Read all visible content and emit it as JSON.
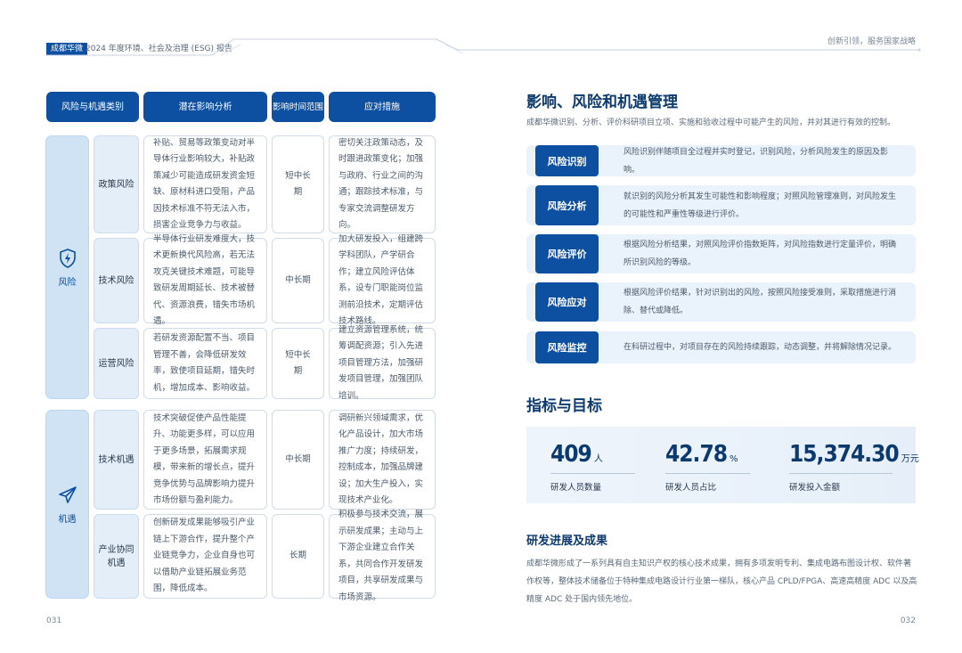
{
  "header": {
    "badge": "成都华微",
    "title": "2024 年度环境、社会及治理 (ESG) 报告",
    "slogan": "创新引领，服务国家战略"
  },
  "table": {
    "headers": [
      "风险与机遇类别",
      "潜在影响分析",
      "影响时间范围",
      "应对措施"
    ],
    "categories": [
      {
        "label": "风险",
        "icon": "shield-lightning-icon",
        "rows": [
          {
            "type": "政策风险",
            "impact": "补贴、贸易等政策变动对半导体行业影响较大，补贴政策减少可能造成研发资金短缺、原材料进口受阻，产品因技术标准不符无法入市，损害企业竞争力与收益。",
            "range": "短中长期",
            "measure": "密切关注政策动态，及时跟进政策变化；加强与政府、行业之间的沟通；跟踪技术标准，与专家交流调整研发方向。"
          },
          {
            "type": "技术风险",
            "impact": "半导体行业研发难度大，技术更新换代风险高，若无法攻克关键技术难题，可能导致研发周期延长、技术被替代、资源浪费，错失市场机遇。",
            "range": "中长期",
            "measure": "加大研发投入，组建跨学科团队，产学研合作；建立风险评估体系，设专门职能岗位监测前沿技术，定期评估技术路线。"
          },
          {
            "type": "运营风险",
            "impact": "若研发资源配置不当、项目管理不善，会降低研发效率，致使项目延期，错失时机，增加成本、影响收益。",
            "range": "短中长期",
            "measure": "建立资源管理系统，统筹调配资源；引入先进项目管理方法，加强研发项目管理，加强团队培训。"
          }
        ]
      },
      {
        "label": "机遇",
        "icon": "paper-plane-icon",
        "rows": [
          {
            "type": "技术机遇",
            "impact": "技术突破促使产品性能提升、功能更多样，可以应用于更多场景，拓展需求规模，带来新的增长点，提升竞争优势与品牌影响力提升市场份额与盈利能力。",
            "range": "中长期",
            "measure": "调研新兴领域需求，优化产品设计，加大市场推广力度；持续研发，控制成本，加强品牌建设；加大生产投入，实现技术产业化。"
          },
          {
            "type": "产业协同机遇",
            "impact": "创新研发成果能够吸引产业链上下游合作，提升整个产业链竞争力，企业自身也可以借助产业链拓展业务范围，降低成本。",
            "range": "长期",
            "measure": "积极参与技术交流，展示研发成果；主动与上下游企业建立合作关系，共同合作开发研发项目，共享研发成果与市场资源。"
          }
        ]
      }
    ]
  },
  "risk_section": {
    "title": "影响、风险和机遇管理",
    "intro": "成都华微识别、分析、评价科研项目立项、实施和验收过程中可能产生的风险，并对其进行有效的控制。",
    "steps": [
      {
        "label": "风险识别",
        "text": "风险识别伴随项目全过程并实时登记，识别风险，分析风险发生的原因及影响。"
      },
      {
        "label": "风险分析",
        "text": "就识别的风险分析其发生可能性和影响程度；对照风险管理准则，对风险发生的可能性和严重性等级进行评价。"
      },
      {
        "label": "风险评价",
        "text": "根据风险分析结果，对照风险评价指数矩阵，对风险指数进行定量评价，明确所识别风险的等级。"
      },
      {
        "label": "风险应对",
        "text": "根据风险评价结果，针对识别出的风险，按照风险接受准则，采取措施进行消除、替代或降低。"
      },
      {
        "label": "风险监控",
        "text": "在科研过程中，对项目存在的风险持续跟踪，动态调整，并将解除情况记录。"
      }
    ]
  },
  "kpi_section": {
    "title": "指标与目标",
    "items": [
      {
        "value": "409",
        "unit": "人",
        "label": "研发人员数量"
      },
      {
        "value": "42.78",
        "unit": "%",
        "label": "研发人员占比"
      },
      {
        "value": "15,374.30",
        "unit": "万元",
        "label": "研发投入金额"
      }
    ]
  },
  "progress_section": {
    "title": "研发进展及成果",
    "text": "成都华微形成了一系列具有自主知识产权的核心技术成果，拥有多项发明专利、集成电路布图设计权、软件著作权等，整体技术储备位于特种集成电路设计行业第一梯队，核心产品 CPLD/FPGA、高速高精度 ADC 以及高精度 ADC 处于国内领先地位。"
  },
  "page_numbers": {
    "left": "031",
    "right": "032"
  }
}
